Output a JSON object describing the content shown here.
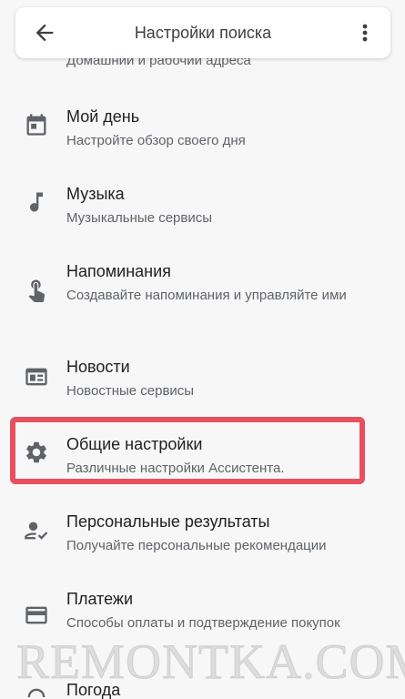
{
  "header": {
    "title": "Настройки поиска",
    "back_icon": "arrow-back-icon",
    "more_icon": "more-vert-icon"
  },
  "clipped_subtitle": "Домашний и рабочий адреса",
  "items": [
    {
      "title": "Мой день",
      "subtitle": "Настройте обзор своего дня",
      "icon": "calendar-icon"
    },
    {
      "title": "Музыка",
      "subtitle": "Музыкальные сервисы",
      "icon": "music-note-icon"
    },
    {
      "title": "Напоминания",
      "subtitle": "Создавайте напоминания и управляйте ими",
      "icon": "reminder-hand-icon"
    },
    {
      "title": "Новости",
      "subtitle": "Новостные сервисы",
      "icon": "news-icon"
    },
    {
      "title": "Общие настройки",
      "subtitle": "Различные настройки Ассистента.",
      "icon": "gear-icon"
    },
    {
      "title": "Персональные результаты",
      "subtitle": "Получайте персональные рекомендации",
      "icon": "person-check-icon"
    },
    {
      "title": "Платежи",
      "subtitle": "Способы оплаты и подтверждение покупок",
      "icon": "credit-card-icon"
    },
    {
      "title": "Погода",
      "subtitle": "",
      "icon": "weather-icon"
    }
  ],
  "highlight_color": "#e8505f",
  "watermark": "REMONTKA.COM"
}
